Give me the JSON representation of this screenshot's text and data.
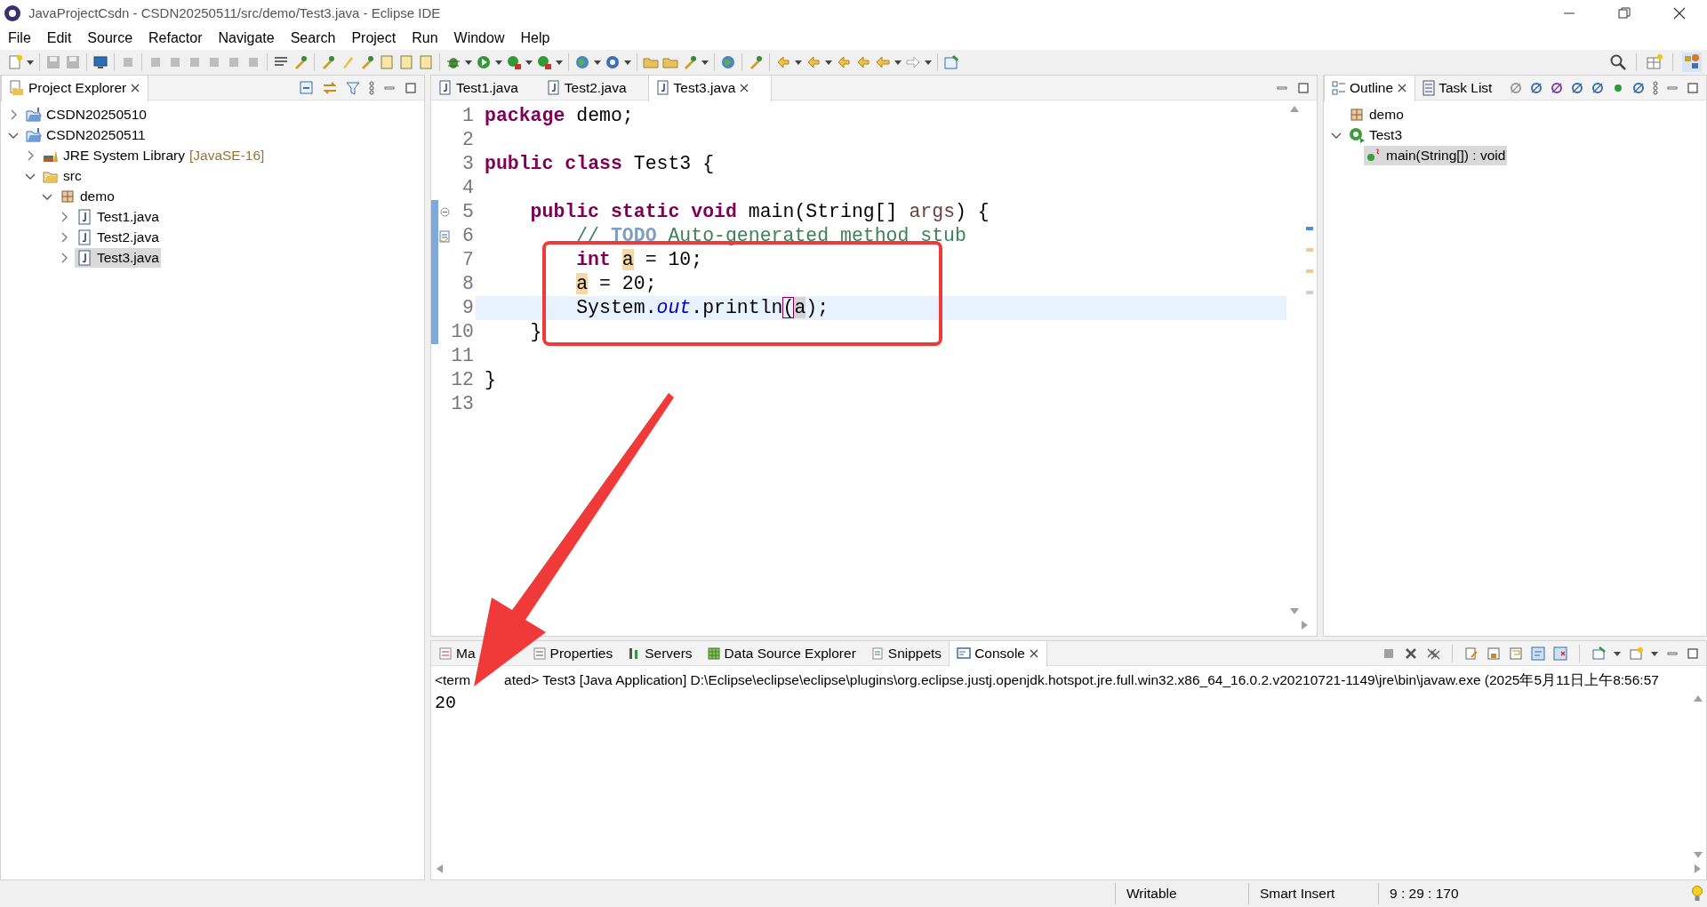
{
  "window": {
    "title": "JavaProjectCsdn - CSDN20250511/src/demo/Test3.java - Eclipse IDE"
  },
  "menu": [
    "File",
    "Edit",
    "Source",
    "Refactor",
    "Navigate",
    "Search",
    "Project",
    "Run",
    "Window",
    "Help"
  ],
  "project_explorer": {
    "title": "Project Explorer",
    "tree": [
      {
        "label": "CSDN20250510",
        "kind": "project",
        "expanded": false,
        "selected": false
      },
      {
        "label": "CSDN20250511",
        "kind": "project",
        "expanded": true,
        "selected": false,
        "children": [
          {
            "label": "JRE System Library",
            "suffix": "[JavaSE-16]",
            "kind": "library",
            "expanded": false,
            "selected": false
          },
          {
            "label": "src",
            "kind": "folder",
            "expanded": true,
            "selected": false,
            "children": [
              {
                "label": "demo",
                "kind": "package",
                "expanded": true,
                "selected": false,
                "children": [
                  {
                    "label": "Test1.java",
                    "kind": "file",
                    "expanded": false,
                    "selected": false
                  },
                  {
                    "label": "Test2.java",
                    "kind": "file",
                    "expanded": false,
                    "selected": false
                  },
                  {
                    "label": "Test3.java",
                    "kind": "file",
                    "expanded": false,
                    "selected": true
                  }
                ]
              }
            ]
          }
        ]
      }
    ]
  },
  "editor": {
    "tabs": [
      {
        "label": "Test1.java",
        "selected": false
      },
      {
        "label": "Test2.java",
        "selected": false
      },
      {
        "label": "Test3.java",
        "selected": true
      }
    ],
    "lines": [
      {
        "number": "1",
        "changed": false,
        "current": false,
        "tokens": [
          {
            "kind": "keyword",
            "text": "package"
          },
          {
            "kind": "plain",
            "text": " demo;"
          }
        ]
      },
      {
        "number": "2",
        "changed": false,
        "current": false
      },
      {
        "number": "3",
        "changed": false,
        "current": false,
        "tokens": [
          {
            "kind": "keyword",
            "text": "public"
          },
          {
            "kind": "keyword",
            "text": " class"
          },
          {
            "kind": "plain",
            "text": " Test3 {"
          }
        ]
      },
      {
        "number": "4",
        "changed": false,
        "current": false
      },
      {
        "number": "5",
        "changed": true,
        "current": false,
        "foldable": true,
        "tokens": [
          {
            "kind": "keyword",
            "text": "    public"
          },
          {
            "kind": "keyword",
            "text": " static"
          },
          {
            "kind": "keyword",
            "text": " void"
          },
          {
            "kind": "plain",
            "text": " main(String[] "
          },
          {
            "kind": "param",
            "text": "args"
          },
          {
            "kind": "plain",
            "text": ") {"
          }
        ]
      },
      {
        "number": "6",
        "changed": true,
        "current": false,
        "task": true,
        "tokens": [
          {
            "kind": "comment",
            "text": "        // "
          },
          {
            "kind": "todo",
            "text": "TODO"
          },
          {
            "kind": "comment",
            "text": " Auto-generated method stub"
          }
        ]
      },
      {
        "number": "7",
        "changed": true,
        "current": false,
        "tokens": [
          {
            "kind": "keyword",
            "text": "        int"
          },
          {
            "kind": "occurrence",
            "text": " a"
          },
          {
            "kind": "plain",
            "text": " = 10;"
          }
        ]
      },
      {
        "number": "8",
        "changed": true,
        "current": false,
        "tokens": [
          {
            "kind": "occurrence",
            "text": "        a"
          },
          {
            "kind": "plain",
            "text": " = 20;"
          }
        ]
      },
      {
        "number": "9",
        "changed": true,
        "current": true,
        "tokens": [
          {
            "kind": "plain",
            "text": "        System."
          },
          {
            "kind": "field",
            "text": "out"
          },
          {
            "kind": "plain",
            "text": ".println"
          },
          {
            "kind": "bracket",
            "text": "("
          },
          {
            "kind": "current-occurrence",
            "text": "a"
          },
          {
            "kind": "plain",
            "text": ");"
          }
        ]
      },
      {
        "number": "10",
        "changed": true,
        "current": false,
        "tokens": [
          {
            "kind": "plain",
            "text": "    }"
          }
        ]
      },
      {
        "number": "11",
        "changed": false,
        "current": false
      },
      {
        "number": "12",
        "changed": false,
        "current": false,
        "tokens": [
          {
            "kind": "plain",
            "text": "}"
          }
        ]
      },
      {
        "number": "13",
        "changed": false,
        "current": false
      }
    ]
  },
  "outline": {
    "tabs": [
      {
        "label": "Outline",
        "selected": true
      },
      {
        "label": "Task List",
        "selected": false
      }
    ],
    "tree": [
      {
        "label": "demo",
        "kind": "package",
        "selected": false
      },
      {
        "label": "Test3",
        "kind": "class",
        "expanded": true,
        "selected": false,
        "children": [
          {
            "label": "main(String[]) : void",
            "kind": "method",
            "selected": true
          }
        ]
      }
    ]
  },
  "console": {
    "tabs": [
      {
        "label": "Ma",
        "kind": "markers",
        "selected": false
      },
      {
        "label": "Properties",
        "kind": "properties",
        "selected": false
      },
      {
        "label": "Servers",
        "kind": "servers",
        "selected": false
      },
      {
        "label": "Data Source Explorer",
        "kind": "datasource",
        "selected": false
      },
      {
        "label": "Snippets",
        "kind": "snippets",
        "selected": false
      },
      {
        "label": "Console",
        "kind": "console",
        "selected": true
      }
    ],
    "description_parts": [
      "<term",
      "ated> Test3 [Java Application] D:\\Eclipse\\eclipse\\eclipse\\plugins\\org.eclipse.justj.openjdk.hotspot.jre.full.win32.x86_64_16.0.2.v20210721-1149\\jre\\bin\\javaw.exe  (2025年5月11日上午8:56:57"
    ],
    "output": "20"
  },
  "status_bar": {
    "mode": "Writable",
    "insert": "Smart Insert",
    "position": "9 : 29 : 170"
  }
}
